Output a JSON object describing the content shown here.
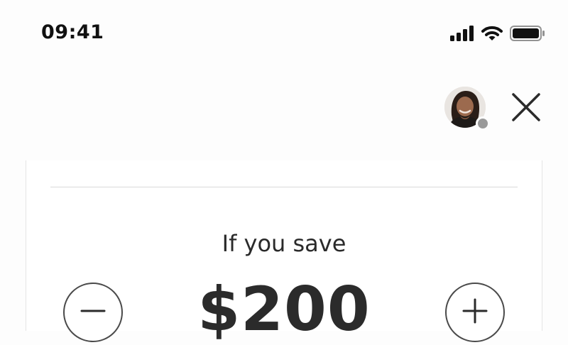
{
  "status_bar": {
    "time": "09:41",
    "icons": [
      "cellular-signal-icon",
      "wifi-icon",
      "battery-icon"
    ]
  },
  "header": {
    "avatar": "user-avatar",
    "presence_color": "#9a9a9a",
    "close_icon": "close-icon"
  },
  "savings": {
    "prompt": "If you save",
    "amount": "$200",
    "decrease_icon": "minus-icon",
    "increase_icon": "plus-icon"
  }
}
